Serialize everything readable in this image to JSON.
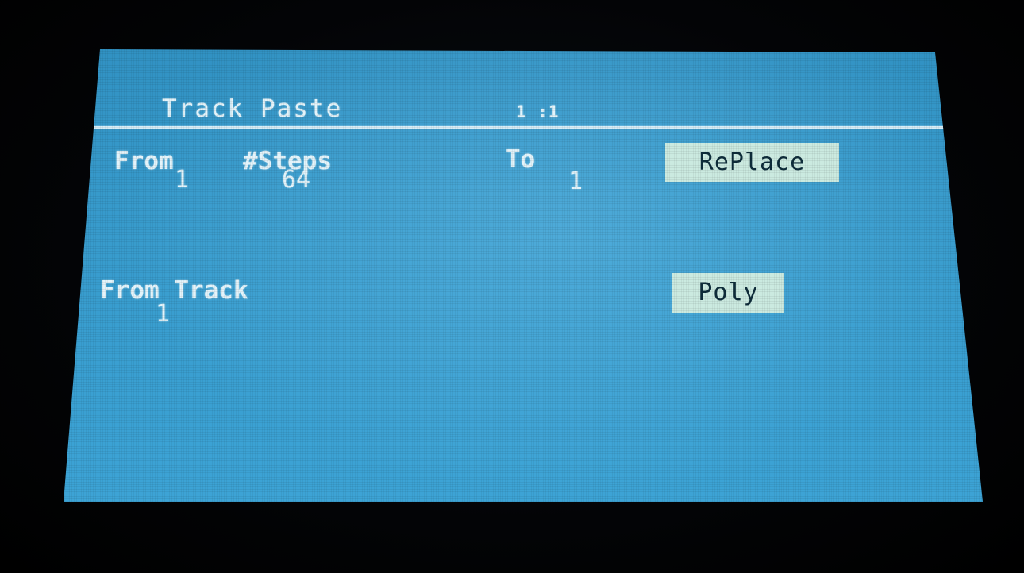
{
  "screen": {
    "title": "Track Paste",
    "page_indicator": "1 :1"
  },
  "params": {
    "from_label": "From",
    "from_value": "1",
    "steps_label": "#Steps",
    "steps_value": "64",
    "to_label": "To",
    "to_value": "1",
    "mode_button": "RePlace",
    "from_track_label": "From Track",
    "from_track_value": "1",
    "poly_button": "Poly"
  },
  "colors": {
    "lcd_background": "#3a9ccd",
    "text": "#e4f4fb",
    "button_background": "#cbeae0",
    "button_text": "#0e2c3a"
  }
}
